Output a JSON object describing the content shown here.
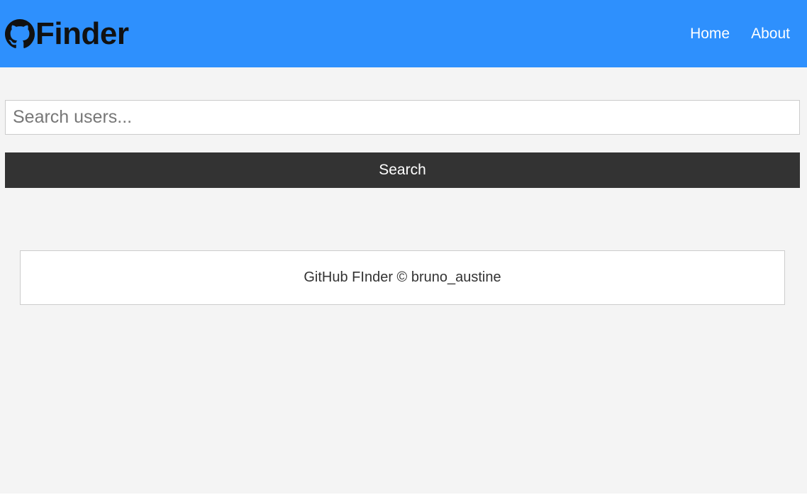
{
  "navbar": {
    "brand_icon": "github-icon",
    "brand_title": "Finder",
    "links": [
      {
        "label": "Home"
      },
      {
        "label": "About"
      }
    ],
    "colors": {
      "background": "#2e90fd",
      "link": "#ffffff"
    }
  },
  "search": {
    "placeholder": "Search users...",
    "value": "",
    "button_label": "Search"
  },
  "footer": {
    "text": "GitHub FInder © bruno_austine"
  },
  "colors": {
    "page_background": "#f4f4f4",
    "button_background": "#333333"
  }
}
